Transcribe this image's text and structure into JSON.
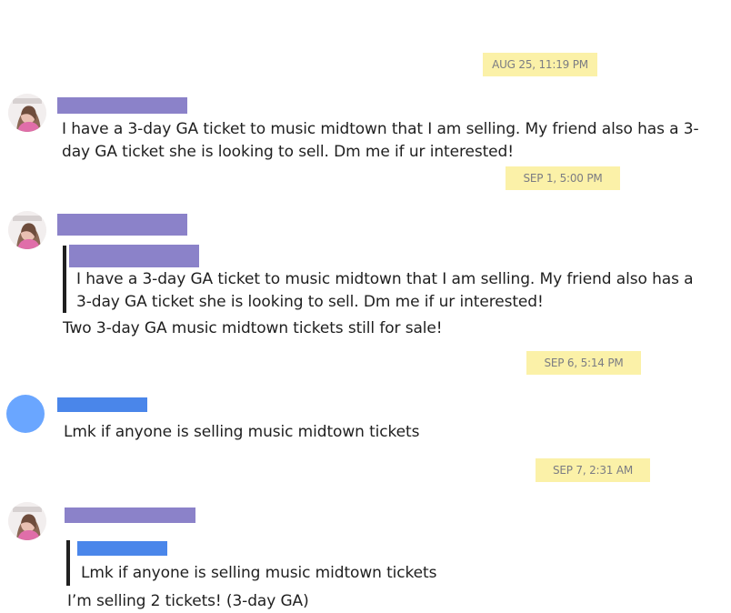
{
  "thread": {
    "messages": [
      {
        "timestamp": "AUG 25, 11:19 PM",
        "text": "I have a 3-day GA ticket to music midtown that I am selling. My friend also has a 3-day GA ticket she is looking to sell. Dm me if ur interested!"
      },
      {
        "timestamp": "SEP 1, 5:00 PM",
        "quoted_text": "I have a 3-day GA ticket to music midtown that I am selling. My friend also has a 3-day GA ticket she is looking to sell. Dm me if ur interested!",
        "text": "Two 3-day GA music midtown tickets still for sale!"
      },
      {
        "timestamp": "SEP 6, 5:14 PM",
        "text": "Lmk if anyone is selling music midtown tickets"
      },
      {
        "timestamp": "SEP 7, 2:31 AM",
        "quoted_text": "Lmk if anyone is selling music midtown tickets",
        "text": "I’m selling 2 tickets! (3-day GA)"
      }
    ]
  },
  "colors": {
    "timestamp_highlight": "#fbf1a8",
    "redacted_name_purple": "#8b82c9",
    "redacted_name_blue": "#4a86ea",
    "avatar_blue": "#6aa6ff",
    "quote_bar": "#202020"
  },
  "icons": {
    "photo_avatar": "user-photo-avatar",
    "blank_avatar": "default-avatar"
  }
}
